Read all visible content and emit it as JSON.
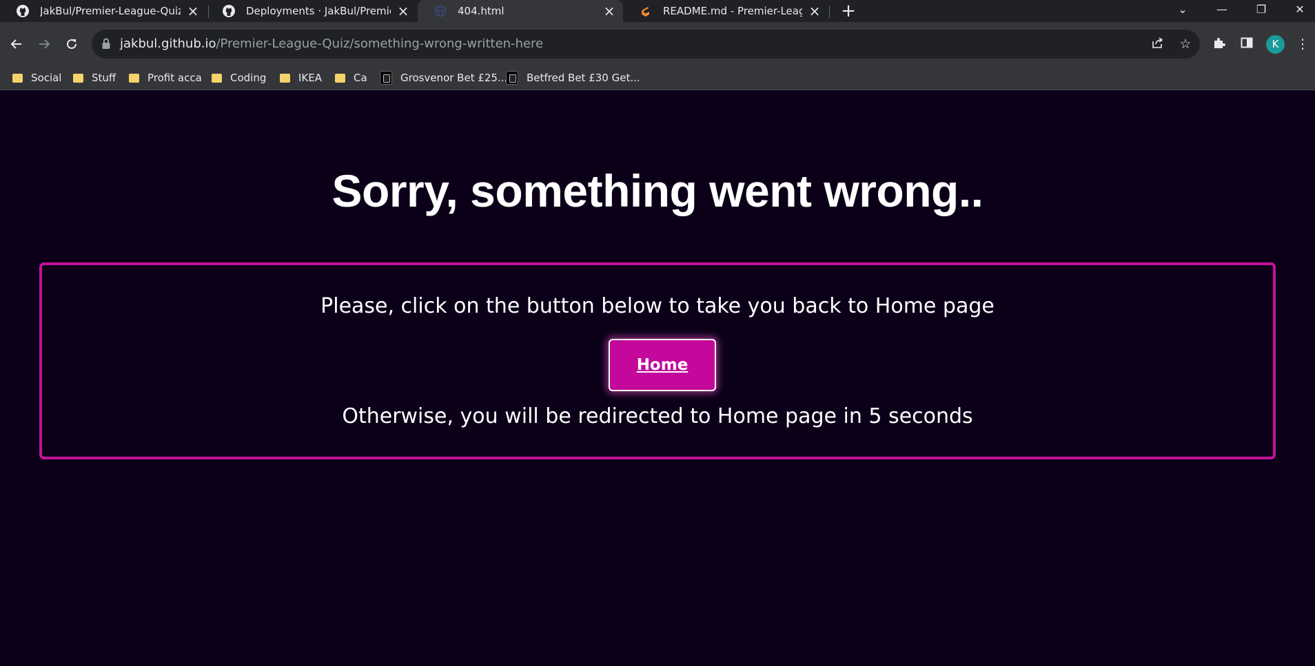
{
  "browser": {
    "tabs": [
      {
        "title": "JakBul/Premier-League-Quiz",
        "icon": "github-icon",
        "active": false
      },
      {
        "title": "Deployments · JakBul/Premier-Le",
        "icon": "github-icon",
        "active": false
      },
      {
        "title": "404.html",
        "icon": "globe-icon",
        "active": true
      },
      {
        "title": "README.md - Premier-League-Q",
        "icon": "gitpod-icon",
        "active": false
      }
    ],
    "new_tab_label": "+",
    "url_host": "jakbul.github.io",
    "url_path": "/Premier-League-Quiz/something-wrong-written-here",
    "profile_initial": "K",
    "bookmarks": [
      {
        "label": "Social",
        "icon": "folder-icon"
      },
      {
        "label": "Stuff",
        "icon": "folder-icon"
      },
      {
        "label": "Profit acca",
        "icon": "folder-icon"
      },
      {
        "label": "Coding",
        "icon": "folder-icon"
      },
      {
        "label": "IKEA",
        "icon": "folder-icon"
      },
      {
        "label": "Ca",
        "icon": "folder-icon"
      },
      {
        "label": "Grosvenor Bet £25...",
        "icon": "site-icon"
      },
      {
        "label": "Betfred Bet £30 Get...",
        "icon": "site-icon"
      }
    ]
  },
  "page": {
    "heading": "Sorry, something went wrong..",
    "instruction": "Please, click on the button below to take you back to Home page",
    "home_button": "Home",
    "redirect_text": "Otherwise, you will be redirected to Home page in 5 seconds"
  },
  "colors": {
    "background": "#0b0018",
    "accent": "#c3129a",
    "text": "#ffffff"
  }
}
